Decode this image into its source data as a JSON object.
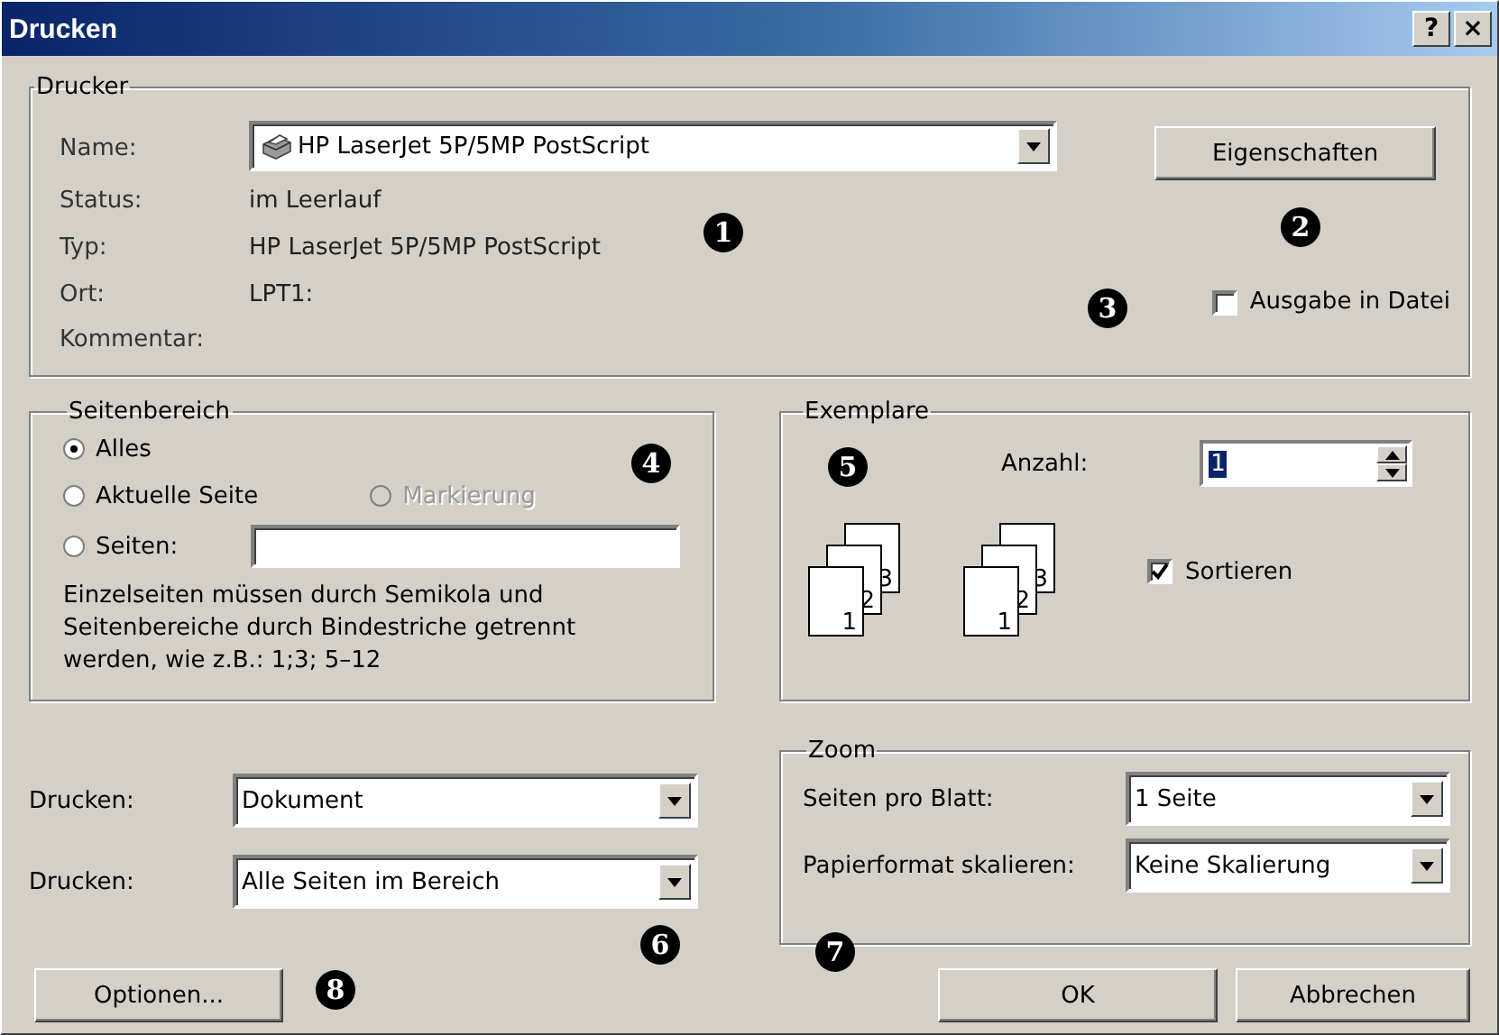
{
  "window": {
    "title": "Drucken",
    "controls": [
      "?",
      "×"
    ]
  },
  "printer": {
    "legend": "Drucker",
    "name": {
      "label": "Name:",
      "value": "HP LaserJet 5P/5MP PostScript"
    },
    "properties_button": {
      "label": "Eigenschaften"
    },
    "info": [
      {
        "label": "Status:",
        "value": "im Leerlauf"
      },
      {
        "label": "Typ:",
        "value": "HP LaserJet 5P/5MP PostScript"
      },
      {
        "label": "Ort:",
        "value": "LPT1:"
      },
      {
        "label": "Kommentar:"
      }
    ],
    "print_to_file": {
      "label": "Ausgabe in Datei",
      "checked": false
    }
  },
  "page_range": {
    "legend": "Seitenbereich",
    "options": [
      {
        "label": "Alles",
        "selected": true,
        "disabled": false
      },
      {
        "label": "Aktuelle Seite",
        "selected": false,
        "disabled": false
      },
      {
        "label": "Markierung",
        "selected": false,
        "disabled": true
      },
      {
        "label": "Seiten:",
        "selected": false,
        "disabled": false
      }
    ],
    "hint": "Einzelseiten müssen durch Semikola und Seitenbereiche durch Bindestriche getrennt werden, wie z.B.: 1;3; 5–12"
  },
  "copies": {
    "legend": "Exemplare",
    "count": {
      "label": "Anzahl:",
      "value": "1",
      "text_selected": true
    },
    "stacks": [
      {
        "pages": [
          "3",
          "2",
          "1"
        ]
      },
      {
        "pages": [
          "3",
          "2",
          "1"
        ]
      }
    ],
    "collate": {
      "label": "Sortieren",
      "checked": true
    }
  },
  "print_what": [
    {
      "label": "Drucken:",
      "value": "Dokument"
    },
    {
      "label": "Drucken:",
      "value": "Alle Seiten im Bereich"
    }
  ],
  "zoom": {
    "legend": "Zoom",
    "rows": [
      {
        "label": "Seiten pro Blatt:",
        "value": "1 Seite"
      },
      {
        "label": "Papierformat skalieren:",
        "value": "Keine Skalierung"
      }
    ]
  },
  "options_button": {
    "label": "Optionen..."
  },
  "buttons": [
    "OK",
    "Abbrechen"
  ],
  "markers": [
    "1",
    "2",
    "3",
    "4",
    "5",
    "6",
    "7",
    "8"
  ]
}
